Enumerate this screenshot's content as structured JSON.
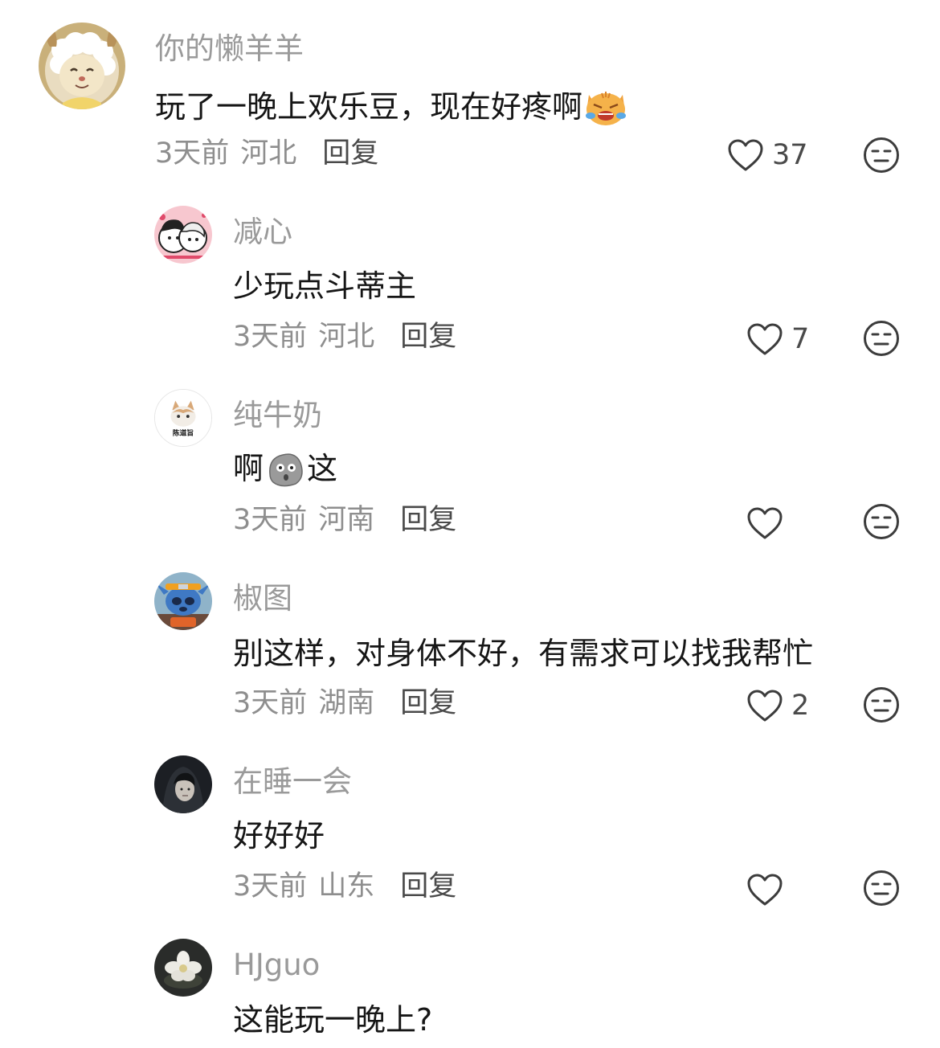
{
  "comments": [
    {
      "username": "你的懒羊羊",
      "text": "玩了一晚上欢乐豆，现在好疼啊",
      "emoji": "crying-cat-emoji",
      "time": "3天前",
      "region": "河北",
      "reply": "回复",
      "likes": "37",
      "avatar": "lazy-sheep-avatar"
    },
    {
      "username": "减心",
      "text": "少玩点斗蒂主",
      "time": "3天前",
      "region": "河北",
      "reply": "回复",
      "likes": "7",
      "avatar": "couple-cartoon-avatar"
    },
    {
      "username": "纯牛奶",
      "text_before": "啊",
      "text_after": "这",
      "emoji": "shocked-potato-emoji",
      "time": "3天前",
      "region": "河南",
      "reply": "回复",
      "likes": "",
      "avatar": "cat-photo-avatar",
      "avatar_caption": "陈道旨"
    },
    {
      "username": "椒图",
      "text": "别这样，对身体不好，有需求可以找我帮忙",
      "time": "3天前",
      "region": "湖南",
      "reply": "回复",
      "likes": "2",
      "avatar": "stitch-naruto-avatar"
    },
    {
      "username": "在睡一会",
      "text": "好好好",
      "time": "3天前",
      "region": "山东",
      "reply": "回复",
      "likes": "",
      "avatar": "dark-portrait-avatar"
    },
    {
      "username": "HJguo",
      "text": "这能玩一晚上?",
      "avatar": "white-flower-avatar"
    }
  ],
  "icons": {
    "like": "heart-outline-icon",
    "dislike": "neutral-face-icon"
  },
  "colors": {
    "username": "#9a9a9a",
    "text": "#161616",
    "meta": "#8e8e8e",
    "icon": "#3c3c3c"
  }
}
